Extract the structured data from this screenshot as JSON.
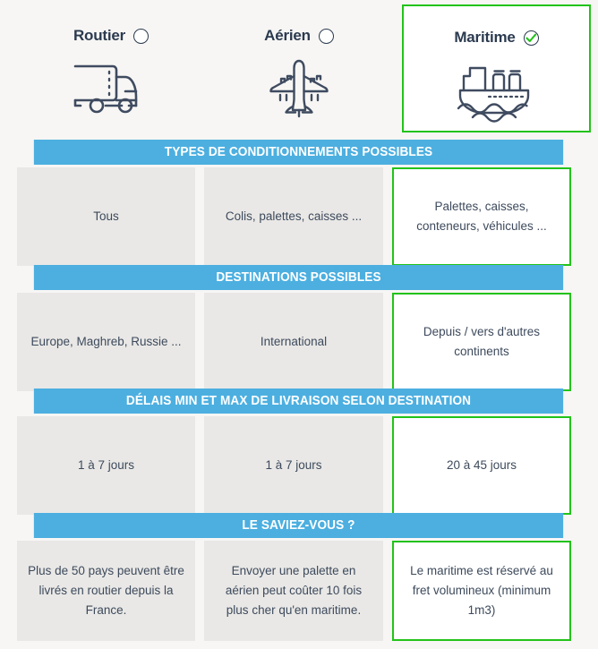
{
  "modes": [
    {
      "label": "Routier",
      "icon": "truck-icon",
      "selected": false,
      "state_icon": "radio-unchecked-icon"
    },
    {
      "label": "Aérien",
      "icon": "airplane-icon",
      "selected": false,
      "state_icon": "radio-unchecked-icon"
    },
    {
      "label": "Maritime",
      "icon": "cargo-ship-icon",
      "selected": true,
      "state_icon": "radio-checked-icon"
    }
  ],
  "sections": [
    {
      "header": "TYPES DE CONDITIONNEMENTS POSSIBLES",
      "cells": [
        "Tous",
        "Colis, palettes, caisses ...",
        "Palettes, caisses, conteneurs, véhicules ..."
      ]
    },
    {
      "header": "DESTINATIONS POSSIBLES",
      "cells": [
        "Europe, Maghreb, Russie ...",
        "International",
        "Depuis / vers d'autres continents"
      ]
    },
    {
      "header": "DÉLAIS MIN ET MAX DE LIVRAISON SELON DESTINATION",
      "cells": [
        "1 à 7 jours",
        "1 à 7 jours",
        "20 à 45 jours"
      ]
    },
    {
      "header": "LE SAVIEZ-VOUS ?",
      "cells": [
        "Plus de 50 pays peuvent être livrés en routier depuis la France.",
        "Envoyer une palette en aérien peut coûter 10 fois plus cher qu'en maritime.",
        "Le maritime est réservé au fret volumineux (minimum 1m3)"
      ]
    }
  ],
  "colors": {
    "header_blue": "#4cafe0",
    "selected_green": "#22c319",
    "cell_gray": "#e9e8e6",
    "page_background": "#f7f6f4",
    "icon_slate": "#3f4b60",
    "text_slate": "#3d4a5c"
  }
}
